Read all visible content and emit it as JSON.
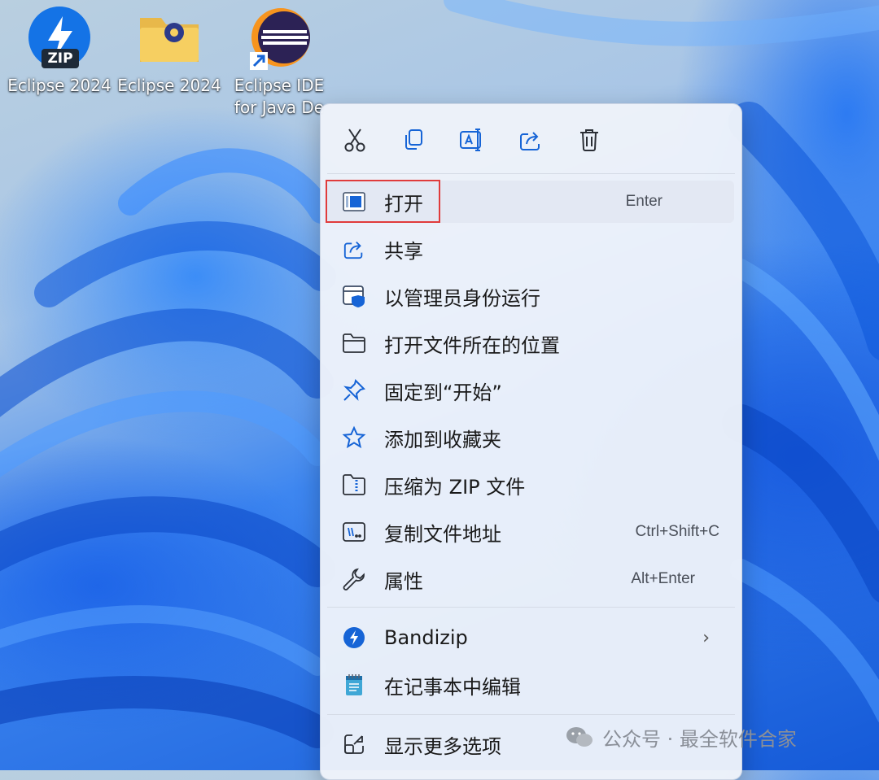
{
  "desktop": {
    "icons": [
      {
        "label": "Eclipse 2024",
        "icon": "bandizip-zip-icon"
      },
      {
        "label": "Eclipse 2024",
        "icon": "folder-icon"
      },
      {
        "label": "Eclipse IDE\nfor Java De",
        "icon": "eclipse-shortcut-icon"
      }
    ],
    "zip_badge": "ZIP"
  },
  "context_menu": {
    "toolbar": [
      {
        "name": "cut",
        "icon": "scissors-icon"
      },
      {
        "name": "copy",
        "icon": "copy-icon"
      },
      {
        "name": "rename",
        "icon": "rename-icon"
      },
      {
        "name": "share",
        "icon": "share-icon"
      },
      {
        "name": "delete",
        "icon": "trash-icon"
      }
    ],
    "items": [
      {
        "label": "打开",
        "shortcut": "Enter",
        "icon": "app-window-icon"
      },
      {
        "label": "共享",
        "shortcut": "",
        "icon": "share-icon"
      },
      {
        "label": "以管理员身份运行",
        "shortcut": "",
        "icon": "admin-shield-icon"
      },
      {
        "label": "打开文件所在的位置",
        "shortcut": "",
        "icon": "folder-icon"
      },
      {
        "label": "固定到“开始”",
        "shortcut": "",
        "icon": "pin-icon"
      },
      {
        "label": "添加到收藏夹",
        "shortcut": "",
        "icon": "star-icon"
      },
      {
        "label": "压缩为 ZIP 文件",
        "shortcut": "",
        "icon": "zip-folder-icon"
      },
      {
        "label": "复制文件地址",
        "shortcut": "Ctrl+Shift+C",
        "icon": "copy-path-icon"
      },
      {
        "label": "属性",
        "shortcut": "Alt+Enter",
        "icon": "wrench-icon"
      },
      {
        "label": "Bandizip",
        "shortcut": "",
        "icon": "bandizip-icon",
        "submenu": "›"
      },
      {
        "label": "在记事本中编辑",
        "shortcut": "",
        "icon": "notepad-icon"
      },
      {
        "label": "显示更多选项",
        "shortcut": "",
        "icon": "more-options-icon"
      }
    ]
  },
  "watermark": {
    "text": "公众号 · 最全软件合家"
  },
  "colors": {
    "accent": "#1664d6",
    "highlight": "#e03b3b",
    "menu_bg": "#eef2fa"
  }
}
